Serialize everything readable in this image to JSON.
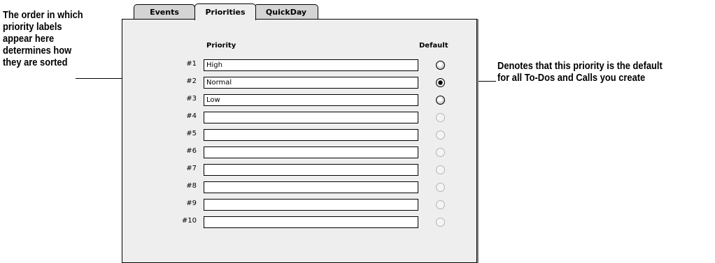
{
  "callouts": {
    "left": [
      "The order in which",
      "priority labels",
      "appear here",
      "determines how",
      "they are sorted"
    ],
    "right": [
      "Denotes that this priority is the default",
      "for all To-Dos and Calls you create"
    ]
  },
  "tabs": {
    "events": "Events",
    "priorities": "Priorities",
    "quickday": "QuickDay"
  },
  "active_tab": "Priorities",
  "headers": {
    "priority": "Priority",
    "default": "Default"
  },
  "priorities": [
    {
      "num": "#1",
      "label": "High",
      "default_state": "enabled"
    },
    {
      "num": "#2",
      "label": "Normal",
      "default_state": "selected"
    },
    {
      "num": "#3",
      "label": "Low",
      "default_state": "enabled"
    },
    {
      "num": "#4",
      "label": "",
      "default_state": "disabled"
    },
    {
      "num": "#5",
      "label": "",
      "default_state": "disabled"
    },
    {
      "num": "#6",
      "label": "",
      "default_state": "disabled"
    },
    {
      "num": "#7",
      "label": "",
      "default_state": "disabled"
    },
    {
      "num": "#8",
      "label": "",
      "default_state": "disabled"
    },
    {
      "num": "#9",
      "label": "",
      "default_state": "disabled"
    },
    {
      "num": "#10",
      "label": "",
      "default_state": "disabled"
    }
  ]
}
